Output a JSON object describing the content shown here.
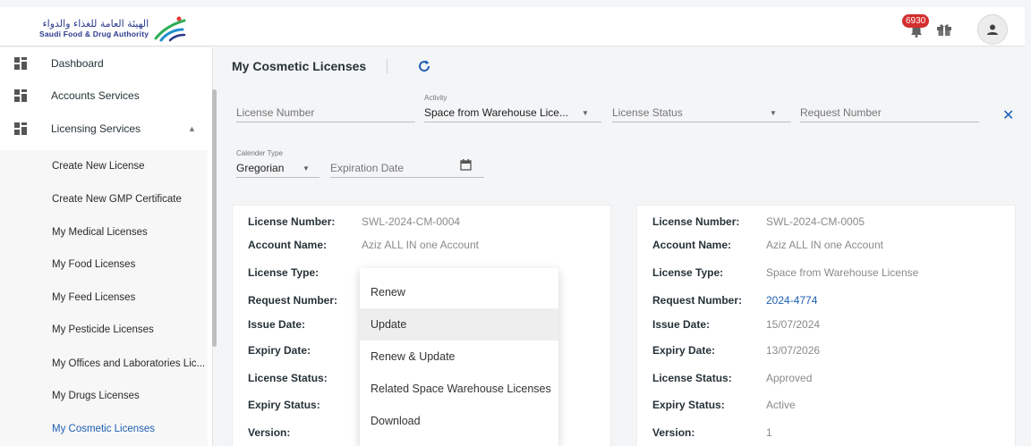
{
  "header": {
    "logo_ar": "الهيئة العامة للغذاء والدواء",
    "logo_en": "Saudi Food & Drug Authority",
    "notification_count": "6930",
    "icons": [
      "bell-icon",
      "gift-icon",
      "user-icon"
    ]
  },
  "sidebar": {
    "items": [
      {
        "label": "Dashboard"
      },
      {
        "label": "Accounts Services"
      },
      {
        "label": "Licensing Services"
      }
    ],
    "sub_items": [
      {
        "label": "Create New License"
      },
      {
        "label": "Create New GMP Certificate"
      },
      {
        "label": "My Medical Licenses"
      },
      {
        "label": "My Food Licenses"
      },
      {
        "label": "My Feed Licenses"
      },
      {
        "label": "My Pesticide Licenses"
      },
      {
        "label": "My Offices and Laboratories Lic..."
      },
      {
        "label": "My Drugs Licenses"
      },
      {
        "label": "My Cosmetic Licenses"
      }
    ]
  },
  "page": {
    "title": "My Cosmetic Licenses"
  },
  "filters": {
    "license_number_placeholder": "License Number",
    "activity_label": "Activity",
    "activity_value": "Space from Warehouse Lice...",
    "license_status_placeholder": "License Status",
    "request_number_placeholder": "Request Number",
    "calendar_label": "Calender Type",
    "calendar_value": "Gregorian",
    "expiration_placeholder": "Expiration Date"
  },
  "cards": [
    {
      "rows": [
        {
          "label": "License Number:",
          "value": "SWL-2024-CM-0004"
        },
        {
          "label": "Account Name:",
          "value": "Aziz ALL IN one Account"
        },
        {
          "label": "License Type:",
          "value": ""
        },
        {
          "label": "Request Number:",
          "value": ""
        },
        {
          "label": "Issue Date:",
          "value": ""
        },
        {
          "label": "Expiry Date:",
          "value": ""
        },
        {
          "label": "License Status:",
          "value": ""
        },
        {
          "label": "Expiry Status:",
          "value": ""
        },
        {
          "label": "Version:",
          "value": ""
        }
      ]
    },
    {
      "rows": [
        {
          "label": "License Number:",
          "value": "SWL-2024-CM-0005"
        },
        {
          "label": "Account Name:",
          "value": "Aziz ALL IN one Account"
        },
        {
          "label": "License Type:",
          "value": "Space from Warehouse License"
        },
        {
          "label": "Request Number:",
          "value": "2024-4774"
        },
        {
          "label": "Issue Date:",
          "value": "15/07/2024"
        },
        {
          "label": "Expiry Date:",
          "value": "13/07/2026"
        },
        {
          "label": "License Status:",
          "value": "Approved"
        },
        {
          "label": "Expiry Status:",
          "value": "Active"
        },
        {
          "label": "Version:",
          "value": "1"
        }
      ]
    }
  ],
  "context_menu": {
    "items": [
      {
        "label": "Renew"
      },
      {
        "label": "Update"
      },
      {
        "label": "Renew & Update"
      },
      {
        "label": "Related Space Warehouse Licenses"
      },
      {
        "label": "Download"
      }
    ],
    "hovered": "Update"
  },
  "colors": {
    "accent": "#1e5fb4",
    "badge": "#d32f2f"
  }
}
